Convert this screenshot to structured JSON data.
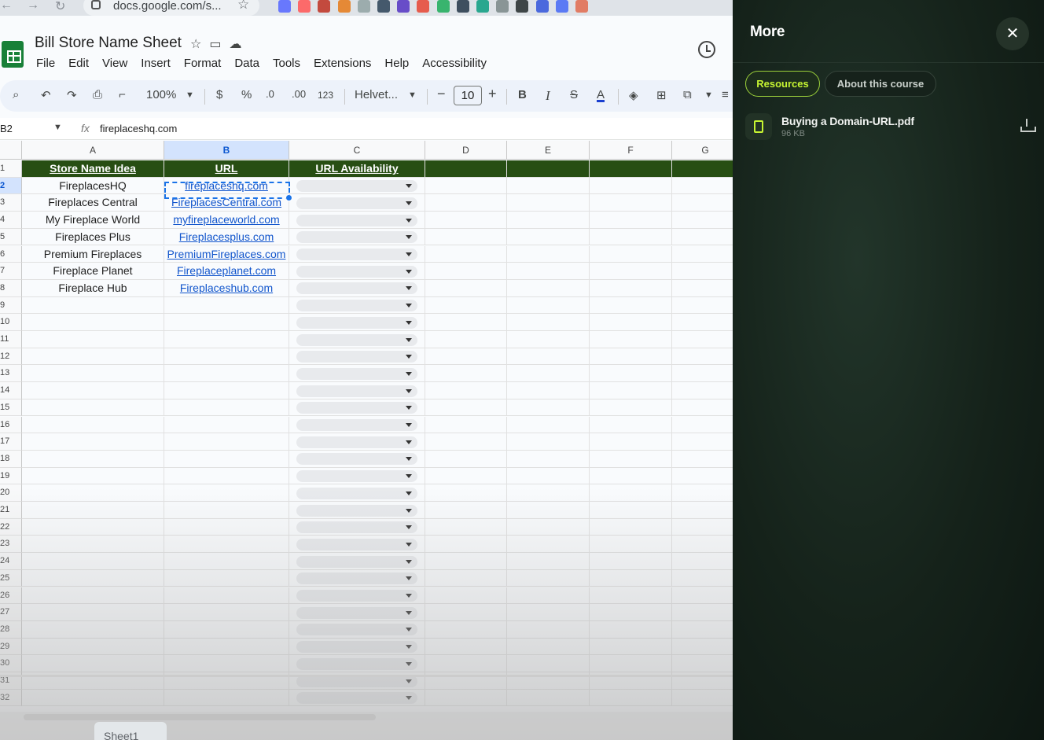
{
  "browser": {
    "url": "docs.google.com/s...",
    "extension_colors": [
      "#5b6cff",
      "#ff5c5c",
      "#c0392b",
      "#e67e22",
      "#95a5a6",
      "#34495e",
      "#5b3cc4",
      "#e74c3c",
      "#27ae60",
      "#2c3e50",
      "#16a085",
      "#7f8c8d",
      "#2d3436",
      "#3b5bdb",
      "#4c6ef5",
      "#e17055"
    ]
  },
  "sheets": {
    "title": "Bill Store Name Sheet",
    "menu": [
      "File",
      "Edit",
      "View",
      "Insert",
      "Format",
      "Data",
      "Tools",
      "Extensions",
      "Help",
      "Accessibility"
    ],
    "toolbar": {
      "zoom": "100%",
      "currency": "$",
      "percent": "%",
      "dec_decrease": ".0",
      "dec_increase": ".00",
      "number_format": "123",
      "font": "Helvet...",
      "font_size": "10",
      "bold": "B",
      "italic": "I",
      "text_color": "A"
    },
    "name_box": "B2",
    "formula": "fireplaceshq.com",
    "columns": [
      "A",
      "B",
      "C",
      "D",
      "E",
      "F",
      "G"
    ],
    "header_row": [
      "Store Name Idea",
      "URL",
      "URL Availability"
    ],
    "rows": [
      {
        "name": "FireplacesHQ",
        "url": "fireplaceshq.com"
      },
      {
        "name": "Fireplaces Central",
        "url": "FireplacesCentral.com"
      },
      {
        "name": "My Fireplace World",
        "url": "myfireplaceworld.com"
      },
      {
        "name": "Fireplaces Plus",
        "url": "Fireplacesplus.com"
      },
      {
        "name": "Premium Fireplaces",
        "url": "PremiumFireplaces.com"
      },
      {
        "name": "Fireplace Planet",
        "url": "Fireplaceplanet.com"
      },
      {
        "name": "Fireplace Hub",
        "url": "Fireplaceshub.com"
      }
    ],
    "row_numbers": [
      "1",
      "2",
      "3",
      "4",
      "5",
      "6",
      "7",
      "8",
      "9",
      "10",
      "11",
      "12",
      "13",
      "14",
      "15",
      "16",
      "17",
      "18",
      "19",
      "20",
      "21",
      "22",
      "23",
      "24",
      "25",
      "26",
      "27",
      "28",
      "29",
      "30",
      "31",
      "32"
    ],
    "sheet_tab": "Sheet1",
    "header_color": "#274e13",
    "link_color": "#1155cc"
  },
  "panel": {
    "title": "More",
    "tabs": [
      {
        "label": "Resources",
        "active": true
      },
      {
        "label": "About this course",
        "active": false
      }
    ],
    "resources": [
      {
        "name": "Buying a Domain-URL.pdf",
        "size": "96 KB",
        "icon": "file-icon"
      }
    ],
    "accent_color": "#c6f432"
  }
}
